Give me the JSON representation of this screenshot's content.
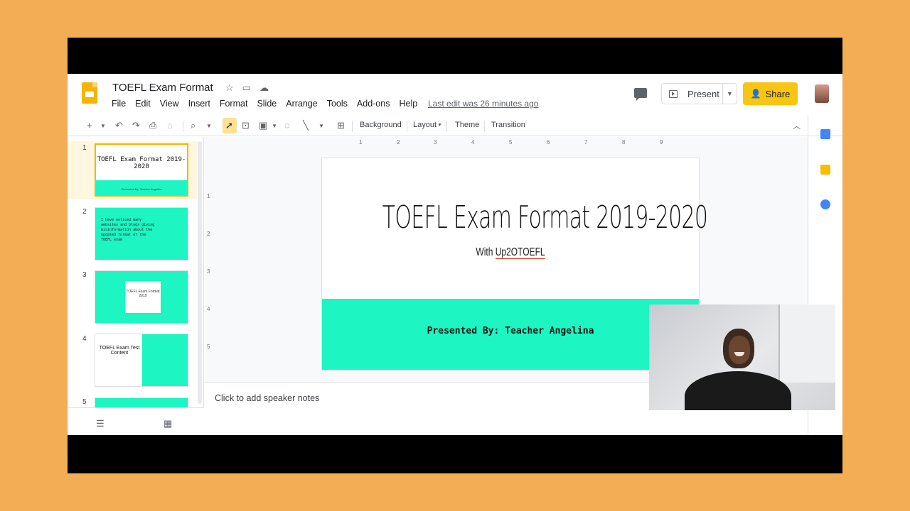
{
  "header": {
    "doc_title": "TOEFL Exam Format",
    "menu": [
      "File",
      "Edit",
      "View",
      "Insert",
      "Format",
      "Slide",
      "Arrange",
      "Tools",
      "Add-ons",
      "Help"
    ],
    "last_edit": "Last edit was 26 minutes ago",
    "present_label": "Present",
    "share_label": "Share"
  },
  "toolbar": {
    "background_label": "Background",
    "layout_label": "Layout",
    "theme_label": "Theme",
    "transition_label": "Transition"
  },
  "filmstrip": {
    "slides": [
      {
        "num": "1",
        "title": "TOEFL Exam Format 2019-2020",
        "band_text": "Presented By: Teacher Angelina"
      },
      {
        "num": "2",
        "text": "I have noticed many websites and blogs giving misinformation about the updated format of the TOEFL exam"
      },
      {
        "num": "3",
        "text": "TOEFL Exam Format 2019"
      },
      {
        "num": "4",
        "text": "TOEFL Exam Test Content"
      },
      {
        "num": "5"
      }
    ]
  },
  "ruler": {
    "h": [
      "1",
      "2",
      "3",
      "4",
      "5",
      "6",
      "7",
      "8",
      "9"
    ],
    "v": [
      "1",
      "2",
      "3",
      "4",
      "5"
    ]
  },
  "slide": {
    "title": "TOEFL Exam Format 2019-2020",
    "subtitle_prefix": "With ",
    "subtitle_link": "Up2OTOEFL",
    "band_text": "Presented By: Teacher Angelina",
    "band_color": "#1df5c3"
  },
  "notes": {
    "placeholder": "Click to add speaker notes"
  },
  "colors": {
    "accent": "#f4b400",
    "share": "#f9c513",
    "teal": "#1df5c3"
  }
}
